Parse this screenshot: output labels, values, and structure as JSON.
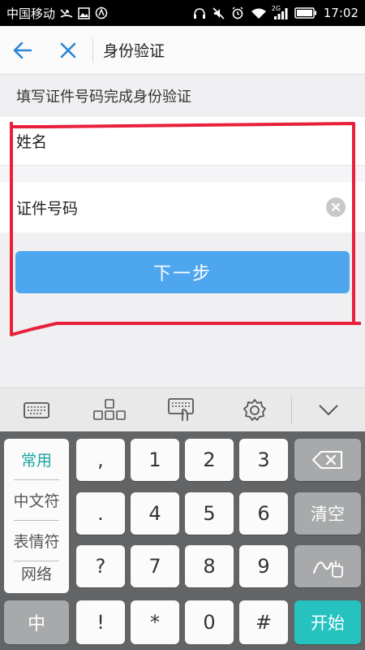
{
  "status_bar": {
    "carrier": "中国移动",
    "network": "2G",
    "time": "17:02"
  },
  "app_bar": {
    "back_icon": "arrow-left-icon",
    "close_icon": "close-icon",
    "title": "身份验证"
  },
  "form": {
    "instruction": "填写证件号码完成身份验证",
    "name_label": "姓名",
    "name_value": "",
    "id_label": "证件号码",
    "id_value": "",
    "next_button": "下一步"
  },
  "keyboard": {
    "toolbar": [
      "keyboard-icon",
      "cursor-navigation-icon",
      "handwriting-keyboard-icon",
      "gear-icon",
      "chevron-down-icon"
    ],
    "side_panel": [
      "常用",
      "中文符",
      "表情符",
      "网络"
    ],
    "keys": {
      "comma": ",",
      "period": ".",
      "question": "?",
      "exclaim": "!",
      "star": "*",
      "zero": "0",
      "hash": "#",
      "one": "1",
      "two": "2",
      "three": "3",
      "four": "4",
      "five": "5",
      "six": "6",
      "seven": "7",
      "eight": "8",
      "nine": "9",
      "clear": "清空",
      "zh": "中",
      "start": "开始"
    }
  },
  "colors": {
    "accent": "#4ea6ee",
    "annotation": "#e8203a",
    "teal": "#26c2bf"
  }
}
